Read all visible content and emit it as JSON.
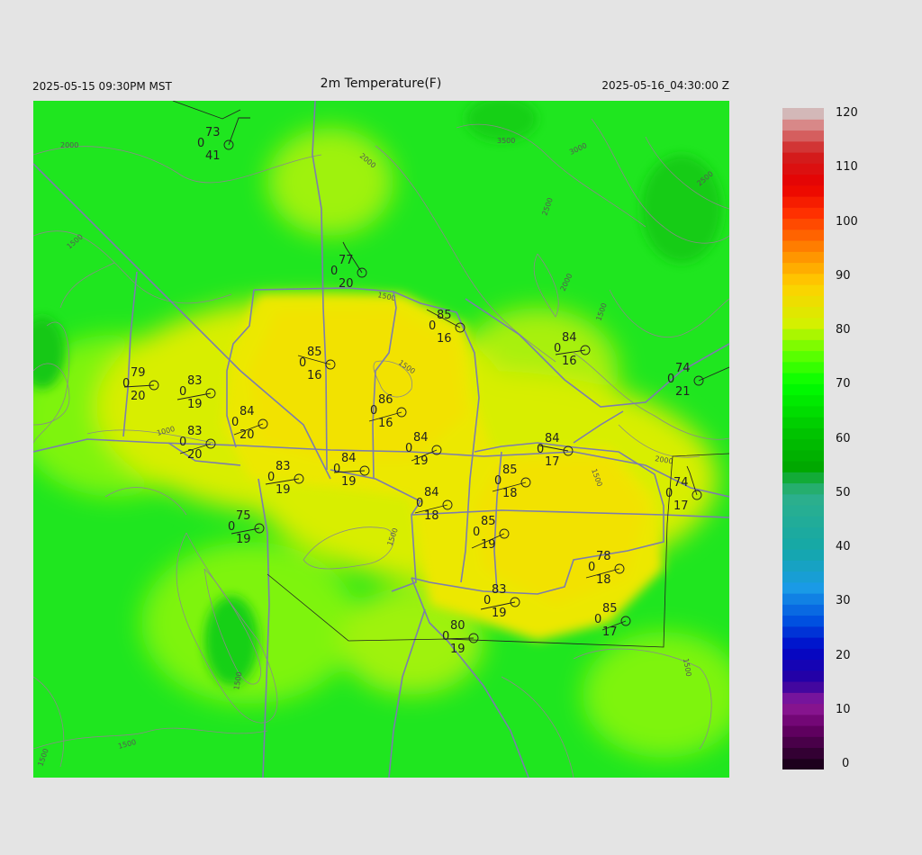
{
  "header": {
    "local_time": "2025-05-15 09:30PM MST",
    "title": "2m Temperature(F)",
    "valid_time": "2025-05-16_04:30:00 Z"
  },
  "colorbar": {
    "min": 0,
    "max": 120,
    "tick_labels": [
      "0",
      "10",
      "20",
      "30",
      "40",
      "50",
      "60",
      "70",
      "80",
      "90",
      "100",
      "110",
      "120"
    ],
    "stops": [
      {
        "v": 0,
        "c": "#120012"
      },
      {
        "v": 8,
        "c": "#6a006a"
      },
      {
        "v": 12,
        "c": "#8f1a9a"
      },
      {
        "v": 16,
        "c": "#2a00a0"
      },
      {
        "v": 22,
        "c": "#0008c8"
      },
      {
        "v": 27,
        "c": "#0050e0"
      },
      {
        "v": 33,
        "c": "#1a9ae6"
      },
      {
        "v": 40,
        "c": "#14a8a8"
      },
      {
        "v": 50,
        "c": "#2eb08a"
      },
      {
        "v": 55,
        "c": "#00a800"
      },
      {
        "v": 62,
        "c": "#00c800"
      },
      {
        "v": 70,
        "c": "#00ff00"
      },
      {
        "v": 76,
        "c": "#6aff00"
      },
      {
        "v": 81,
        "c": "#d4f000"
      },
      {
        "v": 88,
        "c": "#ffd000"
      },
      {
        "v": 94,
        "c": "#ff8a00"
      },
      {
        "v": 101,
        "c": "#ff3000"
      },
      {
        "v": 106,
        "c": "#e80000"
      },
      {
        "v": 112,
        "c": "#d02020"
      },
      {
        "v": 117,
        "c": "#d88888"
      },
      {
        "v": 120,
        "c": "#d0d0d0"
      }
    ]
  },
  "contour_labels": [
    "2000",
    "2000",
    "3500",
    "3000",
    "2500",
    "1500",
    "1500",
    "2500",
    "2000",
    "1500",
    "1000",
    "1500",
    "1500",
    "2000",
    "1500",
    "1500",
    "1500",
    "1500",
    "1500"
  ],
  "stations": [
    {
      "t": "73",
      "d": "41",
      "p": "0"
    },
    {
      "t": "77",
      "d": "20",
      "p": "0"
    },
    {
      "t": "85",
      "d": "16",
      "p": "0"
    },
    {
      "t": "84",
      "d": "16",
      "p": "0"
    },
    {
      "t": "85",
      "d": "16",
      "p": "0"
    },
    {
      "t": "79",
      "d": "20",
      "p": "0"
    },
    {
      "t": "83",
      "d": "19",
      "p": "0"
    },
    {
      "t": "74",
      "d": "21",
      "p": "0"
    },
    {
      "t": "86",
      "d": "16",
      "p": "0"
    },
    {
      "t": "84",
      "d": "20",
      "p": "0"
    },
    {
      "t": "83",
      "d": "20",
      "p": "0"
    },
    {
      "t": "84",
      "d": "17",
      "p": "0"
    },
    {
      "t": "84",
      "d": "19",
      "p": "0"
    },
    {
      "t": "84",
      "d": "19",
      "p": "0"
    },
    {
      "t": "83",
      "d": "19",
      "p": "0"
    },
    {
      "t": "85",
      "d": "18",
      "p": "0"
    },
    {
      "t": "74",
      "d": "17",
      "p": "0"
    },
    {
      "t": "84",
      "d": "18",
      "p": "0"
    },
    {
      "t": "85",
      "d": "19",
      "p": "0"
    },
    {
      "t": "75",
      "d": "19",
      "p": "0"
    },
    {
      "t": "78",
      "d": "18",
      "p": "0"
    },
    {
      "t": "83",
      "d": "19",
      "p": "0"
    },
    {
      "t": "85",
      "d": "17",
      "p": "0"
    },
    {
      "t": "80",
      "d": "19",
      "p": "0"
    }
  ]
}
